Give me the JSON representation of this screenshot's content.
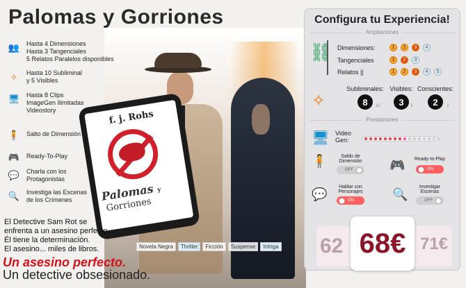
{
  "header": {
    "title": "Palomas y Gorriones"
  },
  "features": [
    {
      "icon": "people-tree-icon",
      "text": "Hasta 4 Dimensiones\nHasta 3 Tangenciales\n5 Relatos Paralelos disponibles"
    },
    {
      "icon": "network-nodes-icon",
      "text": "Hasta 10 Subliminal\ny 5 Visibles"
    },
    {
      "icon": "monitor-icon",
      "text": "Hasta 8 Clips\nImageGen Ilimitadas\nVideostory"
    },
    {
      "icon": "dimension-jump-icon",
      "text": "Salto de Dimensión"
    },
    {
      "icon": "gamepad-icon",
      "text": "Ready-To-Play"
    },
    {
      "icon": "chat-people-icon",
      "text": "Charla con los\nProtagonistas"
    },
    {
      "icon": "magnifier-icon",
      "text": "Investiga las Escenas\nde los Crímenes"
    }
  ],
  "book": {
    "author": "f. j. Rohs",
    "title_line1": "Palomas",
    "title_y": "y",
    "title_line2": "Gorriones"
  },
  "description": "El Detective Sam Rot se\nenfrenta a un asesino perfecto.\nÉl tiene la determinación.\nEl asesino... miles de libros.",
  "tags": [
    "Novela Negra",
    "Thriller",
    "Ficción",
    "Suspense",
    "Intriga"
  ],
  "slogans": {
    "line1": "Un asesino perfecto.",
    "line2": "Un detective obsesionado."
  },
  "config": {
    "title": "Configura tu Experiencia!",
    "section_ampliaciones": "Ampliaciones",
    "section_prestaciones": "Prestaciones",
    "rows": [
      {
        "label": "Dimensiones:",
        "dots": [
          "1",
          "2",
          "3",
          "4"
        ],
        "selected": 3
      },
      {
        "label": "Tangenciales",
        "dots": [
          "1",
          "2",
          "3"
        ],
        "selected": 2
      },
      {
        "label": "Relatos ||",
        "dots": [
          "1",
          "2",
          "3",
          "4",
          "5"
        ],
        "selected": 3
      }
    ],
    "stats": [
      {
        "label": "Subliminales:",
        "value": "8",
        "sub": "10"
      },
      {
        "label": "Visibles:",
        "value": "3",
        "sub": "5"
      },
      {
        "label": "Conscientes:",
        "value": "2",
        "sub": "2"
      }
    ],
    "video_label": "Video\nGen:",
    "video_level": 0.35,
    "options": [
      {
        "icon": "dimension-jump-icon",
        "label": "Saldo de\nDimensión",
        "state": "OFF"
      },
      {
        "icon": "gamepad-icon",
        "label": "Ready-to-Play",
        "state": "ON"
      },
      {
        "icon": "chat-people-icon",
        "label": "Hablar con\nPersonajes",
        "state": "ON"
      },
      {
        "icon": "magnifier-icon",
        "label": "Investigar\nEscenas",
        "state": "OFF"
      }
    ],
    "price_prev": "62",
    "price": "68€",
    "price_next": "71€"
  },
  "colors": {
    "accent": "#d2121b",
    "price": "#8b1428",
    "toggle_on": "#ff5f5f"
  }
}
